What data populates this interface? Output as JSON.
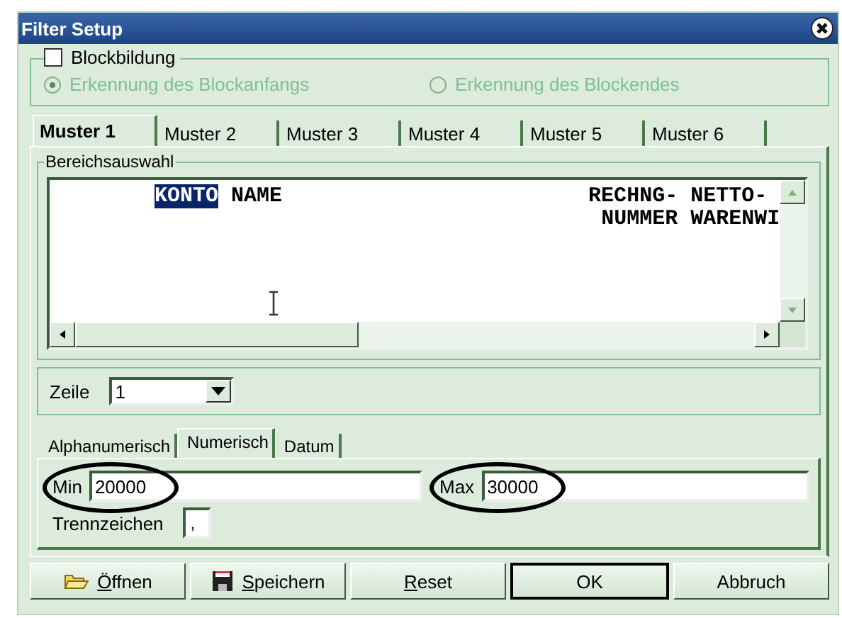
{
  "window": {
    "title": "Filter Setup"
  },
  "blockbildung": {
    "label": "Blockbildung",
    "checked": false
  },
  "radios": [
    {
      "label": "Erkennung des Blockanfangs",
      "selected": true,
      "disabled": true
    },
    {
      "label": "Erkennung des Blockendes",
      "selected": false,
      "disabled": true
    }
  ],
  "tabs": [
    {
      "label": "Muster 1",
      "selected": true
    },
    {
      "label": "Muster 2",
      "selected": false
    },
    {
      "label": "Muster 3",
      "selected": false
    },
    {
      "label": "Muster 4",
      "selected": false
    },
    {
      "label": "Muster 5",
      "selected": false
    },
    {
      "label": "Muster 6",
      "selected": false
    }
  ],
  "range": {
    "title": "Bereichsauswahl",
    "lines": [
      [
        {
          "text": "KONTO",
          "selected": true
        },
        {
          "text": " NAME                        RECHNG- NETTO-",
          "selected": false
        }
      ],
      [
        {
          "text": "                                           NUMMER WARENWI",
          "selected": false
        }
      ]
    ]
  },
  "row": {
    "label": "Zeile",
    "value": "1"
  },
  "subtabs": [
    {
      "label": "Alphanumerisch",
      "selected": false
    },
    {
      "label": "Numerisch",
      "selected": true
    },
    {
      "label": "Datum",
      "selected": false
    }
  ],
  "min": {
    "label": "Min",
    "value": "20000",
    "circled": true
  },
  "max": {
    "label": "Max",
    "value": "30000",
    "circled": true
  },
  "separator": {
    "label": "Trennzeichen",
    "value": ","
  },
  "buttons": [
    {
      "label": "Öffnen",
      "underline_first": true,
      "default": false
    },
    {
      "label": "Speichern",
      "underline_first": true,
      "default": false
    },
    {
      "label": "Reset",
      "underline_first": true,
      "default": false
    },
    {
      "label": "OK",
      "underline_first": false,
      "default": true
    },
    {
      "label": "Abbruch",
      "underline_first": false,
      "default": false
    }
  ]
}
